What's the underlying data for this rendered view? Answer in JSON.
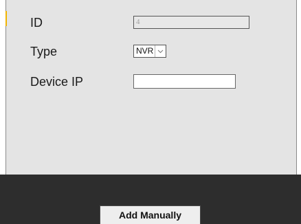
{
  "form": {
    "id_label": "ID",
    "id_value": "4",
    "type_label": "Type",
    "type_value": "NVR",
    "type_dropdown_icon": "chevron-down-icon",
    "device_ip_label": "Device IP",
    "device_ip_value": ""
  },
  "footer": {
    "add_manually_label": "Add Manually"
  },
  "colors": {
    "panel_background": "#e4e4e4",
    "footer_background": "#2d2d2d",
    "accent": "#f0b400",
    "button_background": "#eeeeee"
  }
}
